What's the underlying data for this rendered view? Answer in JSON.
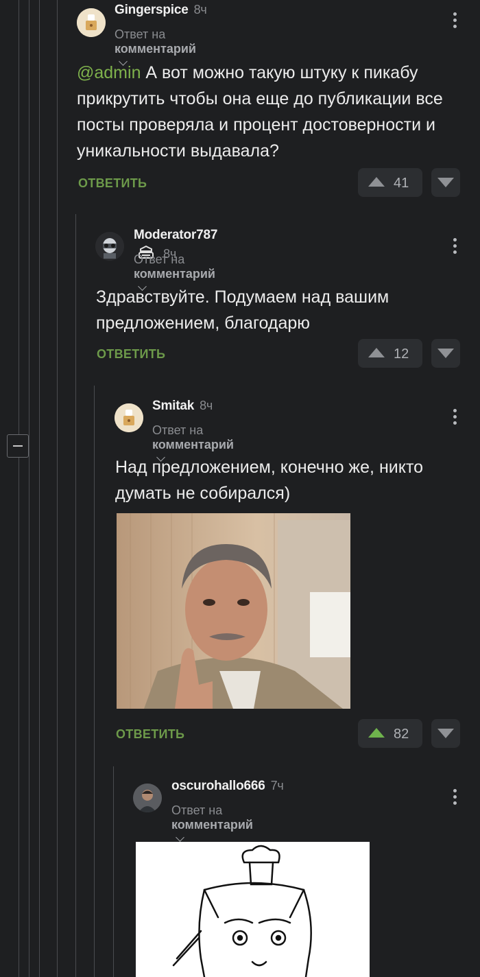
{
  "comments": [
    {
      "author": "Gingerspice",
      "time": "8ч",
      "reply_prefix": "Ответ на",
      "reply_target": "комментарий",
      "mention": "@admin",
      "text": " А вот можно такую штуку к пикабу прикрутить чтобы она еще до публикации все посты проверяла и процент достоверности и уникальности выдавала?",
      "reply_label": "ОТВЕТИТЬ",
      "rating": "41"
    },
    {
      "author": "Moderator787",
      "time": "8ч",
      "badge_icon": "moderator-badge-icon",
      "reply_prefix": "Ответ на",
      "reply_target": "комментарий",
      "text": "Здравствуйте. Подумаем над вашим предложением, благодарю",
      "reply_label": "ОТВЕТИТЬ",
      "rating": "12"
    },
    {
      "author": "Smitak",
      "time": "8ч",
      "reply_prefix": "Ответ на",
      "reply_target": "комментарий",
      "text": "Над предложением, конечно же, никто думать не собирался)",
      "reply_label": "ОТВЕТИТЬ",
      "rating": "82",
      "upvoted": true
    },
    {
      "author": "oscurohallo666",
      "time": "7ч",
      "reply_prefix": "Ответ на",
      "reply_target": "комментарий"
    }
  ],
  "colors": {
    "background": "#1e1f21",
    "accent_green": "#6d9a4a",
    "upvote_active": "#6fb34d",
    "mention": "#7fb24c"
  }
}
